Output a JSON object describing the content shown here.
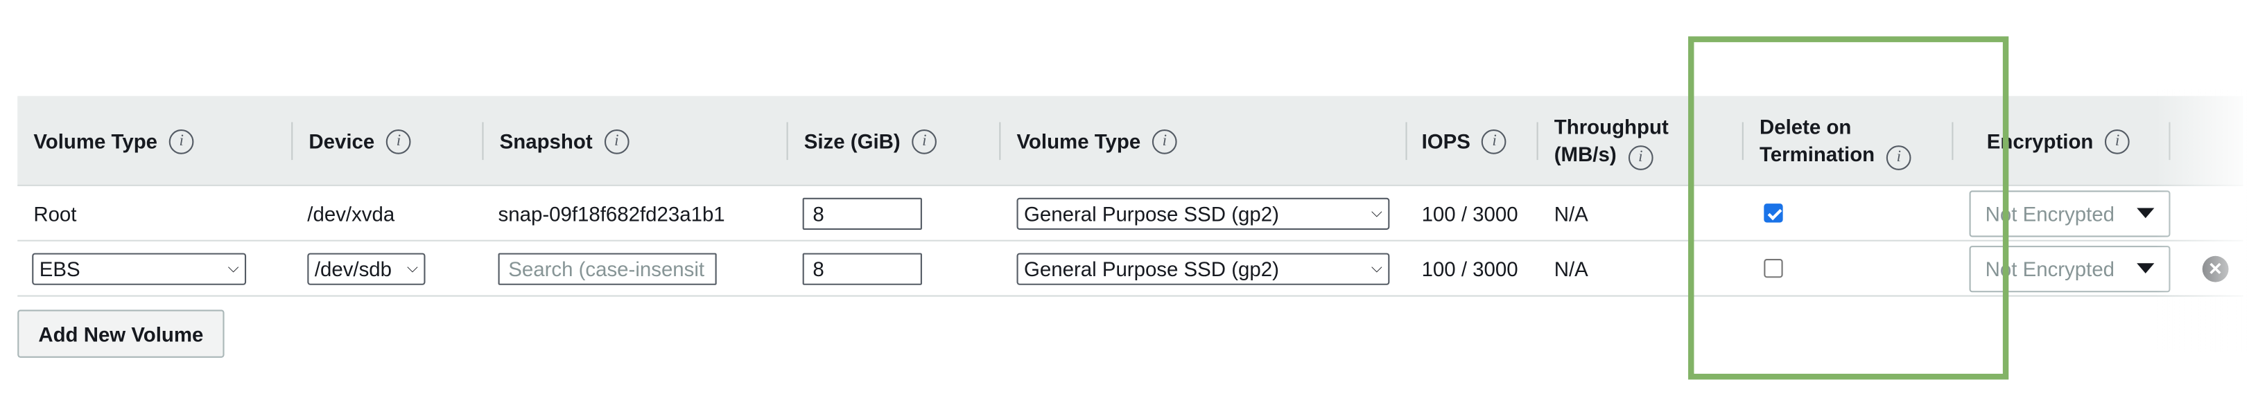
{
  "columns": [
    {
      "label": "Volume Type"
    },
    {
      "label": "Device"
    },
    {
      "label": "Snapshot"
    },
    {
      "label": "Size (GiB)"
    },
    {
      "label": "Volume Type"
    },
    {
      "label": "IOPS"
    },
    {
      "label_line1": "Throughput",
      "label_line2": "(MB/s)"
    },
    {
      "label_line1": "Delete on",
      "label_line2": "Termination"
    },
    {
      "label": "Encryption"
    }
  ],
  "info_icon_glyph": "i",
  "rows": [
    {
      "volume_type": "Root",
      "device": "/dev/xvda",
      "snapshot": "snap-09f18f682fd23a1b1",
      "size": "8",
      "ebs_volume_type": "General Purpose SSD (gp2)",
      "iops": "100 / 3000",
      "throughput": "N/A",
      "delete_on_termination": true,
      "encryption": "Not Encrypted"
    },
    {
      "volume_type": "EBS",
      "device": "/dev/sdb",
      "snapshot_placeholder": "Search (case-insensit",
      "size": "8",
      "ebs_volume_type": "General Purpose SSD (gp2)",
      "iops": "100 / 3000",
      "throughput": "N/A",
      "delete_on_termination": false,
      "encryption": "Not Encrypted",
      "remove_glyph": "✕"
    }
  ],
  "add_button_label": "Add New Volume",
  "colors": {
    "highlight": "#82b366",
    "checkbox": "#1a73e8",
    "header_bg": "#eaeded"
  }
}
